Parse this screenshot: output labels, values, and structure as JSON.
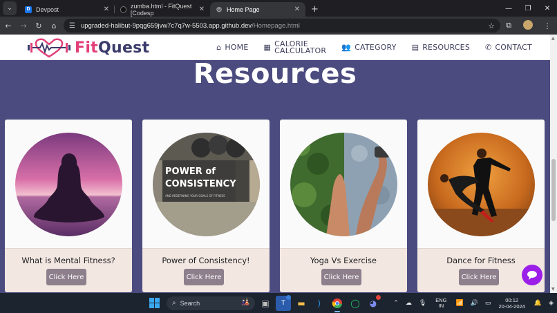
{
  "browser": {
    "tabs": [
      {
        "title": "Devpost",
        "favicon": "D"
      },
      {
        "title": "zumba.html - FitQuest [Codesp",
        "favicon": "github"
      },
      {
        "title": "Home Page",
        "favicon": "globe"
      }
    ],
    "new_tab": "+",
    "url_host": "upgraded-halibut-9pqg659jvw7c7q7w-5503.app.github.dev",
    "url_path": "/Homepage.html"
  },
  "site": {
    "logo_fit": "Fit",
    "logo_quest": "Quest",
    "nav": [
      {
        "label": "HOME",
        "icon": "home-icon"
      },
      {
        "label": "CALORIE",
        "label2": "CALCULATOR",
        "icon": "calculator-icon"
      },
      {
        "label": "CATEGORY",
        "icon": "users-icon"
      },
      {
        "label": "RESOURCES",
        "icon": "book-icon"
      },
      {
        "label": "CONTACT",
        "icon": "phone-icon"
      }
    ],
    "heading": "Resources",
    "cards": [
      {
        "title": "What is Mental Fitness?",
        "button": "Click Here"
      },
      {
        "title": "Power of Consistency!",
        "button": "Click Here",
        "img_line1": "POWER of",
        "img_line2": "CONSISTENCY",
        "img_small": "AND REDEFINING YOUR GOALS OF FITNESS"
      },
      {
        "title": "Yoga Vs Exercise",
        "button": "Click Here"
      },
      {
        "title": "Dance for Fitness",
        "button": "Click Here"
      }
    ]
  },
  "taskbar": {
    "search": "Search",
    "lang1": "ENG",
    "lang2": "IN",
    "time": "00:12",
    "date": "20-04-2024"
  },
  "colors": {
    "page_bg": "#4b4b7f",
    "brand_pink": "#e2407a",
    "brand_navy": "#3b3b6b",
    "button": "#8e7f8c",
    "chat": "#9b1fe8"
  }
}
